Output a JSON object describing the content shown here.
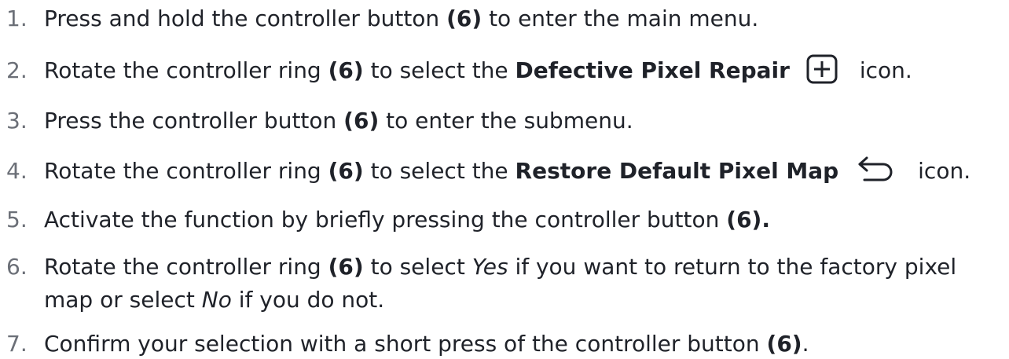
{
  "steps": [
    {
      "num": "1.",
      "t1": "Press and hold the controller button ",
      "b1": "(6)",
      "t2": " to enter the main menu."
    },
    {
      "num": "2.",
      "t1": "Rotate the controller ring ",
      "b1": "(6)",
      "t2": " to select the ",
      "b2": "Defective Pixel Repair",
      "icon": "plus-square-icon",
      "t3": "icon."
    },
    {
      "num": "3.",
      "t1": "Press the controller button ",
      "b1": "(6)",
      "t2": " to enter the submenu."
    },
    {
      "num": "4.",
      "t1": "Rotate the controller ring ",
      "b1": "(6)",
      "t2": " to select the ",
      "b2": "Restore Default Pixel Map",
      "icon": "return-arrow-icon",
      "t3": "icon."
    },
    {
      "num": "5.",
      "t1": "Activate the function by briefly pressing the controller button ",
      "b1": "(6)."
    },
    {
      "num": "6.",
      "t1": "Rotate the controller ring ",
      "b1": "(6)",
      "t2": " to select ",
      "i1": "Yes",
      "t3": " if you want to return to the factory pixel",
      "t4": "map or select ",
      "i2": "No",
      "t5": " if you do not."
    },
    {
      "num": "7.",
      "t1": "Confirm your selection with a short press of the controller button ",
      "b1": "(6)",
      "t2": "."
    }
  ]
}
